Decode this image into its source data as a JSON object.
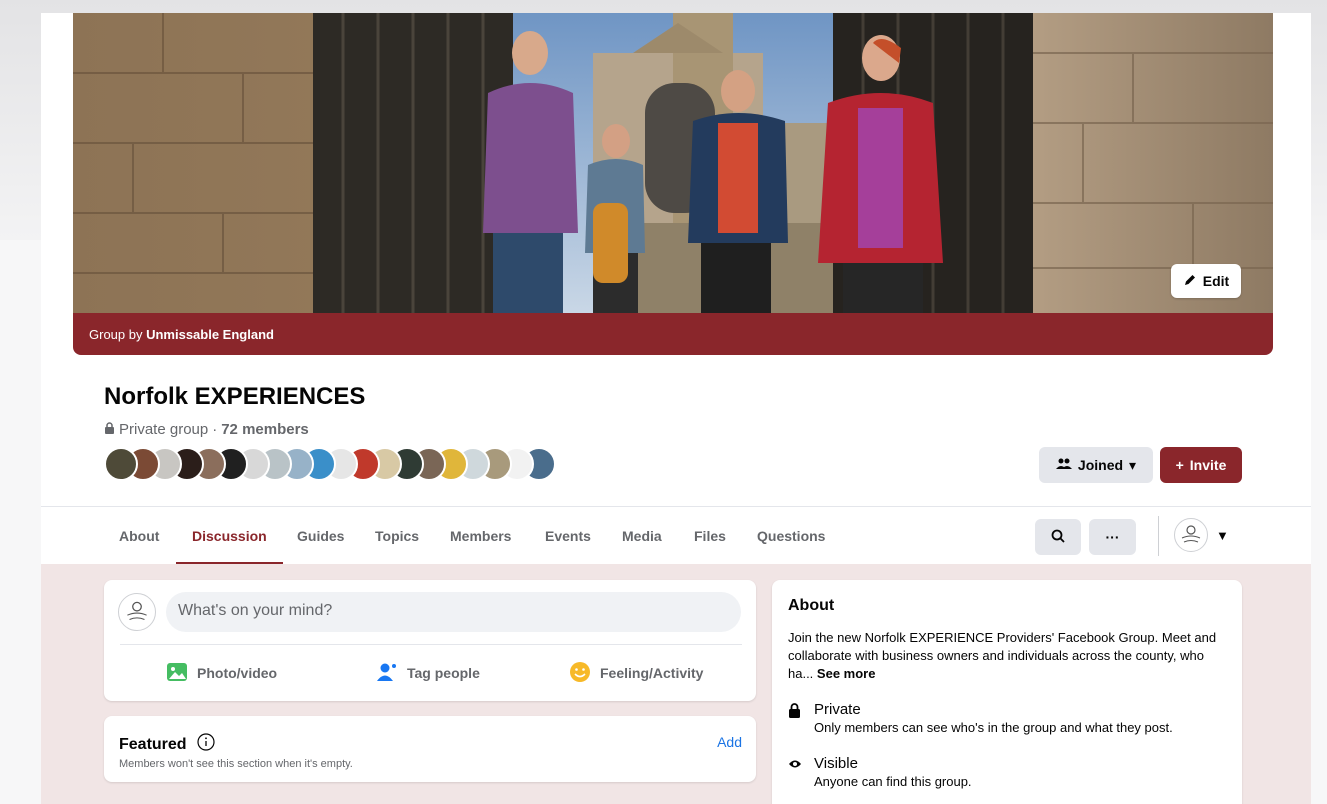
{
  "cover": {
    "group_by_prefix": "Group by ",
    "group_by_name": "Unmissable England",
    "edit_label": "Edit"
  },
  "group": {
    "name": "Norfolk EXPERIENCES",
    "privacy": "Private group",
    "separator": " · ",
    "members": "72 members"
  },
  "member_avatar_colors": [
    "#4e4a38",
    "#7b4a35",
    "#c8c6c2",
    "#2b1e1a",
    "#8b6e5c",
    "#202020",
    "#d8d8d8",
    "#b9c3c7",
    "#97b2c8",
    "#3a8fc9",
    "#e6e6e6",
    "#c0392b",
    "#d8c9a5",
    "#2f3b34",
    "#7a6656",
    "#e0b63a",
    "#cfd8dc",
    "#a89a7c",
    "#f2f2f2",
    "#4a6d8c"
  ],
  "actions": {
    "joined_label": "Joined",
    "invite_label": "Invite"
  },
  "tabs": [
    {
      "label": "About"
    },
    {
      "label": "Discussion"
    },
    {
      "label": "Guides"
    },
    {
      "label": "Topics"
    },
    {
      "label": "Members"
    },
    {
      "label": "Events"
    },
    {
      "label": "Media"
    },
    {
      "label": "Files"
    },
    {
      "label": "Questions"
    }
  ],
  "active_tab": "Discussion",
  "more_label": "···",
  "composer": {
    "placeholder": "What's on your mind?",
    "photo_label": "Photo/video",
    "tag_label": "Tag people",
    "feeling_label": "Feeling/Activity"
  },
  "featured": {
    "title": "Featured",
    "subtitle": "Members won't see this section when it's empty.",
    "add_label": "Add"
  },
  "about": {
    "title": "About",
    "description": "Join the new Norfolk EXPERIENCE Providers' Facebook Group. Meet and collaborate with business owners and individuals across the county, who ha...",
    "see_more": "See more",
    "private_title": "Private",
    "private_desc": "Only members can see who's in the group and what they post.",
    "visible_title": "Visible",
    "visible_desc": "Anyone can find this group."
  },
  "colors": {
    "brand": "#8a262b",
    "link": "#1b74e4",
    "content_background": "#f1e5e5"
  }
}
